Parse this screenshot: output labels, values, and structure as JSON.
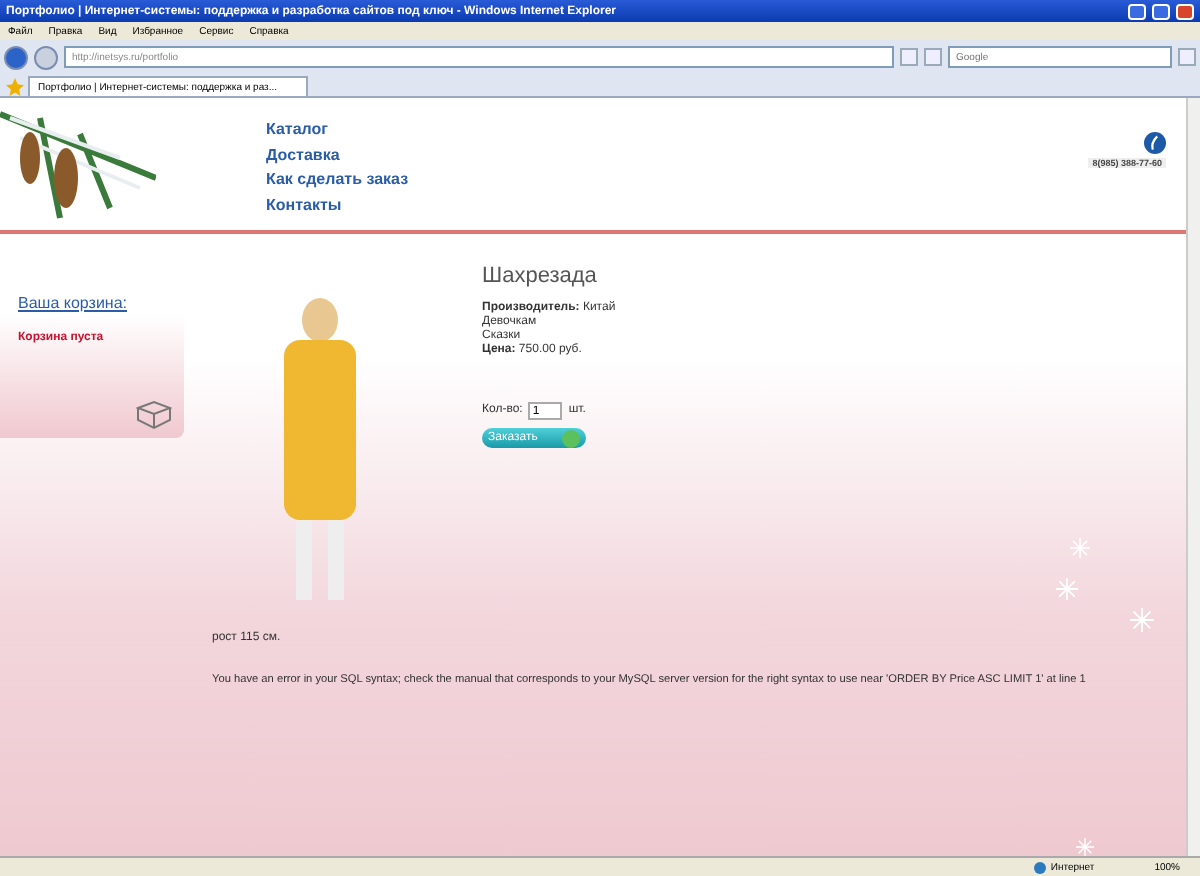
{
  "window": {
    "title": "Портфолио | Интернет-системы: поддержка и разработка сайтов под ключ - Windows Internet Explorer"
  },
  "menu": [
    "Файл",
    "Правка",
    "Вид",
    "Избранное",
    "Сервис",
    "Справка"
  ],
  "address": {
    "value": "http://inetsys.ru/portfolio"
  },
  "search": {
    "placeholder": "Google"
  },
  "tabs": [
    {
      "label": "Портфолио | Интернет-системы: поддержка и раз...",
      "selected": true
    }
  ],
  "page": {
    "nav": [
      "Каталог",
      "Доставка",
      "Как сделать заказ",
      "Контакты"
    ],
    "phone": "8(985) 388-77-60",
    "cart": {
      "title": "Ваша корзина:",
      "status": "Корзина пуста"
    },
    "product": {
      "name": "Шахрезада",
      "details": [
        "**Производитель:** Китай",
        "Девочкам",
        "Сказки",
        "**Цена:** 750.00 руб."
      ],
      "quantity_label": "Кол-во:",
      "quantity": "1",
      "unit": "шт.",
      "order_button": "Заказать",
      "caption": "рост 115 см."
    },
    "error": "You have an error in your SQL syntax; check the manual that corresponds to your MySQL server version for the right syntax to use near 'ORDER BY Price ASC LIMIT 1' at line 1"
  },
  "status_bar": {
    "zone": "Интернет",
    "zoom": "100%"
  }
}
